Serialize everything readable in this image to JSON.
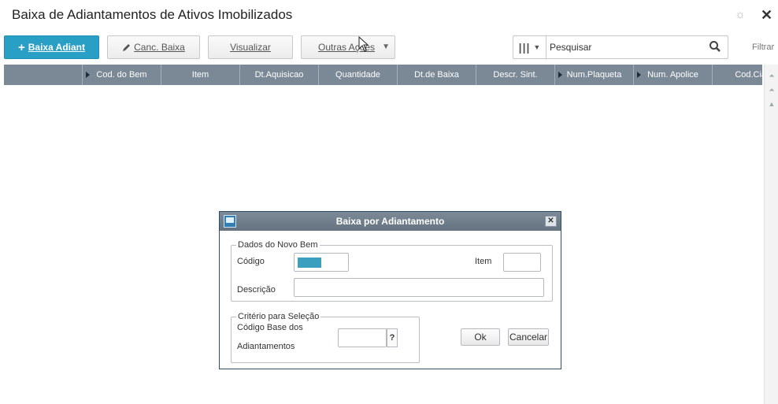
{
  "page": {
    "title": "Baixa de Adiantamentos de Ativos Imobilizados"
  },
  "toolbar": {
    "primary_label": "Baixa Adiant",
    "cancel_label": "Canc. Baixa",
    "view_label": "Visualizar",
    "other_label": "Outras Ações"
  },
  "search": {
    "value": "Pesquisar"
  },
  "filter_label": "Filtrar",
  "grid": {
    "columns": [
      {
        "label": "",
        "arrow": false
      },
      {
        "label": "Cod. do Bem",
        "arrow": true
      },
      {
        "label": "Item",
        "arrow": false
      },
      {
        "label": "Dt.Aquisicao",
        "arrow": false
      },
      {
        "label": "Quantidade",
        "arrow": false
      },
      {
        "label": "Dt.de Baixa",
        "arrow": false
      },
      {
        "label": "Descr. Sint.",
        "arrow": false
      },
      {
        "label": "Num.Plaqueta",
        "arrow": true
      },
      {
        "label": "Num. Apolice",
        "arrow": true
      },
      {
        "label": "Cod.Cia.Seg",
        "arrow": false
      }
    ]
  },
  "dialog": {
    "title": "Baixa por Adiantamento",
    "group1": {
      "legend": "Dados do Novo Bem",
      "codigo_label": "Código",
      "item_label": "Item",
      "descricao_label": "Descrição"
    },
    "group2": {
      "legend": "Critério para Seleção",
      "base_label_line1": "Código Base dos",
      "base_label_line2": "Adiantamentos",
      "help_label": "?"
    },
    "ok_label": "Ok",
    "cancel_label": "Cancelar"
  },
  "colors": {
    "accent": "#2a9fc5",
    "grid_header": "#7b8896",
    "dialog_title": "#6f7c8a"
  }
}
